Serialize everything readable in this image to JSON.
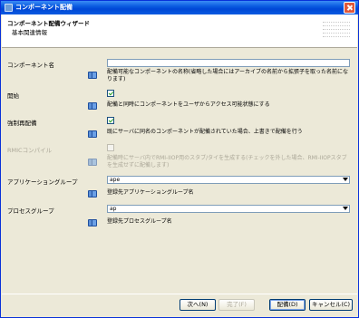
{
  "window": {
    "title": "コンポーネント配備"
  },
  "header": {
    "wizard_title": "コンポーネント配備ウィザード",
    "subtitle": "基本関連情報"
  },
  "fields": {
    "component_name": {
      "label": "コンポーネント名",
      "value": "",
      "description": "配備可能なコンポーネントの名称(省略した場合にはアーカイブの名前から拡張子を取った名前になります)"
    },
    "start": {
      "label": "開始",
      "checked": true,
      "description": "配備と同時にコンポーネントをユーザからアクセス可能状態にする"
    },
    "force_redeploy": {
      "label": "強制再配備",
      "checked": true,
      "description": "既にサーバに同名のコンポーネントが配備されていた場合、上書きで配備を行う"
    },
    "rmic_compile": {
      "label": "RMICコンパイル",
      "checked": false,
      "enabled": false,
      "description": "配備時にサーバ内でRMI-IIOP用のスタブ/タイを生成する(チェックを外した場合、RMI-IIOPスタブを生成せずに配備します)"
    },
    "application_group": {
      "label": "アプリケーショングループ",
      "selected": "ape",
      "description": "登録先アプリケーショングループ名"
    },
    "process_group": {
      "label": "プロセスグループ",
      "selected": "ap",
      "description": "登録先プロセスグループ名"
    }
  },
  "buttons": {
    "next": "次へ(N)",
    "finish": "完了(F)",
    "deploy": "配備(D)",
    "cancel": "キャンセル(C)"
  },
  "icons": {
    "window_icon": "window-icon",
    "close": "close-icon",
    "help": "book-icon",
    "dropdown": "chevron-down-icon"
  }
}
